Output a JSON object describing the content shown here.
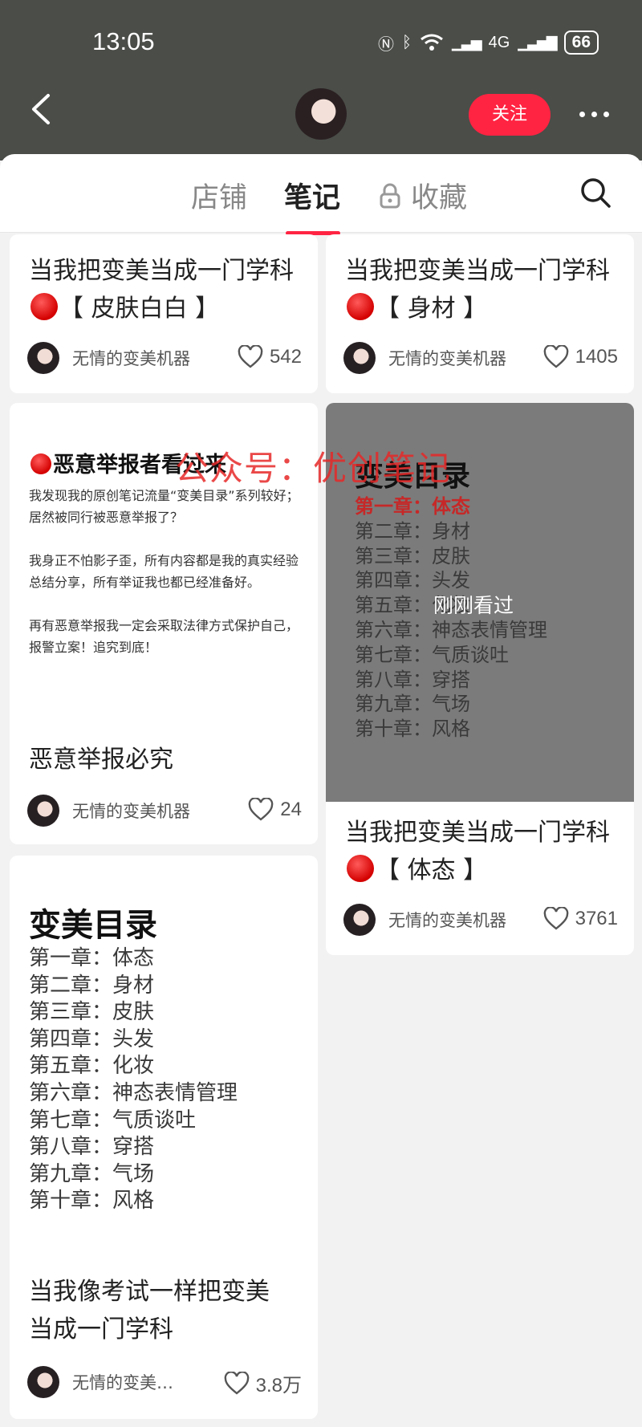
{
  "status": {
    "time": "13:05",
    "network": "4G",
    "battery": "66"
  },
  "header": {
    "follow_label": "关注"
  },
  "tabs": {
    "shop": "店铺",
    "notes": "笔记",
    "collect": "收藏"
  },
  "cards": [
    {
      "title_a": "当我把变美当成一门学科",
      "title_b": "【 皮肤白白 】",
      "author": "无情的变美机器",
      "likes": "542"
    },
    {
      "title_a": "当我把变美当成一门学科",
      "title_b": "【 身材 】",
      "author": "无情的变美机器",
      "likes": "1405"
    },
    {
      "cover_heading": "恶意举报者看过来",
      "cover_paragraphs": [
        "我发现我的原创笔记流量“变美目录”系列较好；居然被同行被恶意举报了？",
        "我身正不怕影子歪，所有内容都是我的真实经验总结分享，所有举证我也都已经准备好。",
        "再有恶意举报我一定会采取法律方式保护自己，报警立案！追究到底！"
      ],
      "title": "恶意举报必究",
      "author": "无情的变美机器",
      "likes": "24"
    },
    {
      "cover_title": "变美目录",
      "cover_badge": "刚刚看过",
      "title_a": "当我把变美当成一门学科",
      "title_b": "【 体态 】",
      "author": "无情的变美机器",
      "likes": "3761"
    },
    {
      "cover_title": "变美目录",
      "title": "当我像考试一样把变美当成一门学科",
      "author": "无情的变美…",
      "likes": "3.8万"
    }
  ],
  "catalog": [
    "第一章：体态",
    "第二章：身材",
    "第三章：皮肤",
    "第四章：头发",
    "第五章：化妆",
    "第六章：神态表情管理",
    "第七章：气质谈吐",
    "第八章：穿搭",
    "第九章：气场",
    "第十章：风格"
  ],
  "watermark": "公众号：优创笔记",
  "colors": {
    "accent": "#ff2442",
    "header_bg": "#4a4d48",
    "chapter_highlight": "#c62828"
  }
}
